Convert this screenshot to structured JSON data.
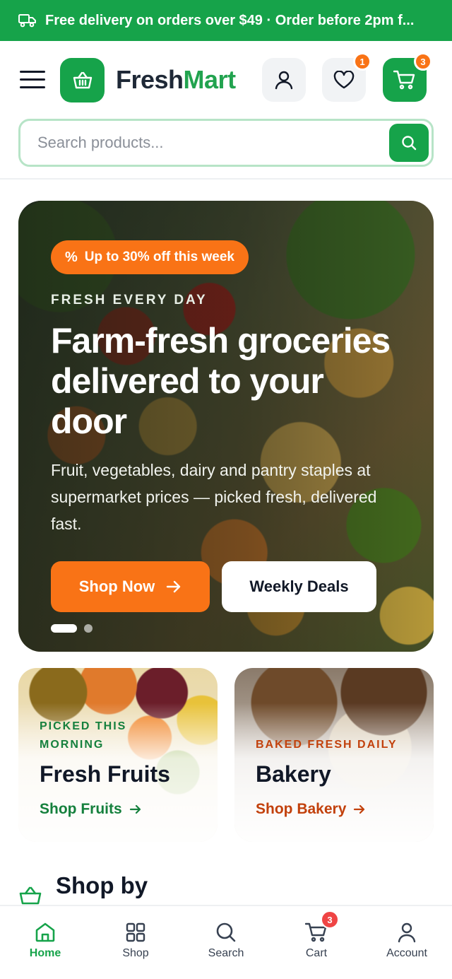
{
  "announcement": {
    "text": "Free delivery on orders over $49 · Order before 2pm f..."
  },
  "header": {
    "logo_part1": "Fresh",
    "logo_part2": "Mart",
    "wishlist_count": "1",
    "cart_count": "3"
  },
  "search": {
    "placeholder": "Search products..."
  },
  "hero": {
    "promo": "Up to 30% off this week",
    "eyebrow": "FRESH EVERY DAY",
    "headline": "Farm-fresh groceries delivered to your door",
    "subtitle": "Fruit, vegetables, dairy and pantry staples at supermarket prices — picked fresh, delivered fast.",
    "primary_label": "Shop Now",
    "secondary_label": "Weekly Deals",
    "slides": 2,
    "active_slide": 1
  },
  "categories": [
    {
      "eyebrow": "PICKED THIS MORNING",
      "title": "Fresh Fruits",
      "link": "Shop Fruits",
      "accent": "#15803d"
    },
    {
      "eyebrow": "BAKED FRESH DAILY",
      "title": "Bakery",
      "link": "Shop Bakery",
      "accent": "#c2410c"
    }
  ],
  "section": {
    "title": "Shop by"
  },
  "bottom_nav": [
    {
      "label": "Home",
      "icon": "home-icon",
      "active": true
    },
    {
      "label": "Shop",
      "icon": "grid-icon"
    },
    {
      "label": "Search",
      "icon": "search-icon"
    },
    {
      "label": "Cart",
      "icon": "cart-icon",
      "badge": "3"
    },
    {
      "label": "Account",
      "icon": "user-icon"
    }
  ],
  "colors": {
    "brand": "#16a34a",
    "accent": "#f97316",
    "badge": "#ef4444"
  }
}
